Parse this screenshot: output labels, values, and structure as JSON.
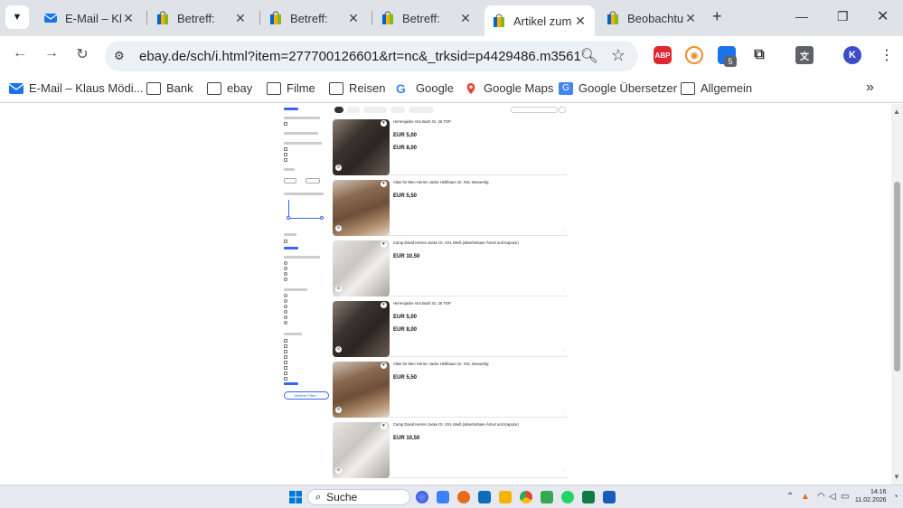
{
  "browser": {
    "tabs": [
      {
        "title": "E-Mail – Kl",
        "icon": "mail-icon",
        "active": false
      },
      {
        "title": "Betreff:",
        "icon": "ebay-bag-icon",
        "active": false
      },
      {
        "title": "Betreff:",
        "icon": "ebay-bag-icon",
        "active": false
      },
      {
        "title": "Betreff:",
        "icon": "ebay-bag-icon",
        "active": false
      },
      {
        "title": "Artikel zum",
        "icon": "ebay-bag-icon",
        "active": true
      },
      {
        "title": "Beobachtu",
        "icon": "ebay-bag-icon",
        "active": false
      }
    ],
    "new_tab_label": "+",
    "url": "ebay.de/sch/i.html?item=277700126601&rt=nc&_trksid=p4429486.m3561.l17...",
    "extensions": {
      "abp": "ABP",
      "badge_count": "5",
      "profile_initial": "K"
    },
    "bookmarks": [
      {
        "label": "E-Mail – Klaus Mödi...",
        "icon": "mail-icon"
      },
      {
        "label": "Bank",
        "icon": "folder-icon"
      },
      {
        "label": "ebay",
        "icon": "folder-icon"
      },
      {
        "label": "Filme",
        "icon": "folder-icon"
      },
      {
        "label": "Reisen",
        "icon": "folder-icon"
      },
      {
        "label": "Google",
        "icon": "google-icon"
      },
      {
        "label": "Google Maps",
        "icon": "maps-pin-icon"
      },
      {
        "label": "Google Übersetzer",
        "icon": "translate-icon"
      },
      {
        "label": "Allgemein",
        "icon": "folder-icon"
      }
    ],
    "more_bookmarks": "»"
  },
  "page": {
    "sidebar_button": "Weitere Filter...",
    "listings": [
      {
        "title": "Herrenjacke Von Bush Gr. 25 TOP",
        "price": "EUR 5,00",
        "price2": "EUR 8,00",
        "image": "dark"
      },
      {
        "title": "Atlas for Men Herren Jacke Hellbraun Gr. XXL Neuwertig",
        "price": "EUR 5,50",
        "price2": "",
        "image": "brown"
      },
      {
        "title": "Camp David Herren Jacke Gr. XXL Weiß (abnehmbare Ärmel und Kapuze)",
        "price": "EUR 10,50",
        "price2": "",
        "image": "white"
      },
      {
        "title": "Herrenjacke Von Bush Gr. 25 TOP",
        "price": "EUR 5,00",
        "price2": "EUR 8,00",
        "image": "dark"
      },
      {
        "title": "Atlas for Men Herren Jacke Hellbraun Gr. XXL Neuwertig",
        "price": "EUR 5,50",
        "price2": "",
        "image": "brown"
      },
      {
        "title": "Camp David Herren Jacke Gr. XXL Weiß (abnehmbare Ärmel und Kapuze)",
        "price": "EUR 10,50",
        "price2": "",
        "image": "white"
      }
    ]
  },
  "taskbar": {
    "search_label": "Suche",
    "time": "14:16",
    "date": "11.02.2026"
  },
  "colors": {
    "tabbar_bg": "#dfe3e8",
    "ebay_blue": "#3665f3",
    "abp_red": "#e0262e"
  }
}
